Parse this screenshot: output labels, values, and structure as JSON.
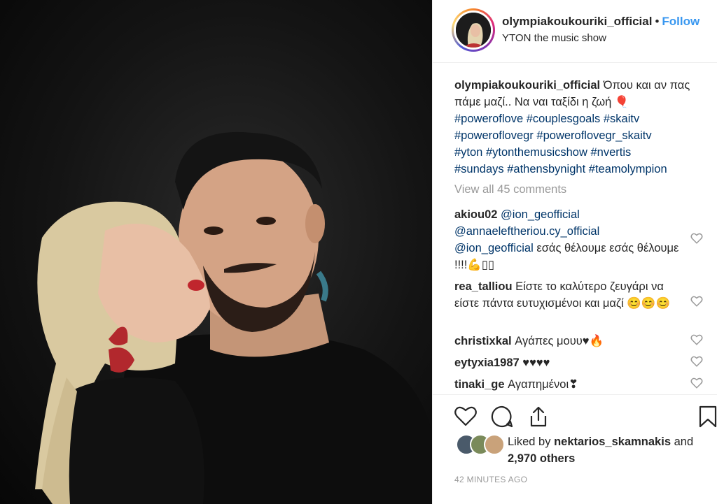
{
  "header": {
    "username": "olympiakoukouriki_official",
    "separator": "•",
    "follow_label": "Follow",
    "location": "YTON the music show"
  },
  "caption": {
    "username": "olympiakoukouriki_official",
    "text": "Όπου και αν πας πάμε μαζί.. Να ναι ταξίδι η ζωή 🎈",
    "hashtags": [
      "#poweroflove",
      "#couplesgoals",
      "#skaitv",
      "#poweroflovegr",
      "#poweroflovegr_skaitv",
      "#yton",
      "#ytonthemusicshow",
      "#nvertis",
      "#sundays",
      "#athensbynight",
      "#teamolympion"
    ]
  },
  "view_all_label": "View all 45 comments",
  "comments": [
    {
      "user": "akiou02",
      "mentions": [
        "@ion_geofficial",
        "@annaeleftheriou.cy_official",
        "@ion_geofficial"
      ],
      "text": "εσάς θέλουμε εσάς θέλουμε !!!!💪▯▯"
    },
    {
      "user": "rea_talliou",
      "text": "Είστε το καλύτερο ζευγάρι να είστε πάντα ευτυχισμένοι και μαζί 😊😊😊"
    },
    {
      "user": "christixkal",
      "text": "Αγάπες μουυ♥🔥"
    },
    {
      "user": "eytyxia1987",
      "text": "♥♥♥♥"
    },
    {
      "user": "tinaki_ge",
      "text": "Αγαπημένοι❣"
    }
  ],
  "likes": {
    "prefix": "Liked by",
    "user": "nektarios_skamnakis",
    "and": "and",
    "others": "2,970 others"
  },
  "timestamp": "42 MINUTES AGO",
  "icons": {
    "like": "heart-icon",
    "comment": "comment-icon",
    "share": "share-icon",
    "save": "bookmark-icon",
    "comment_like": "heart-outline-icon"
  },
  "colors": {
    "link_blue": "#3897f0",
    "hashtag": "#003569",
    "muted": "#999999",
    "text": "#262626"
  }
}
